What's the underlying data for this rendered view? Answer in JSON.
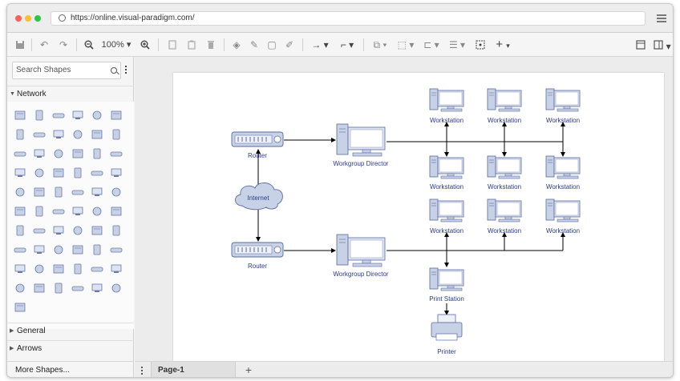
{
  "browser": {
    "url": "https://online.visual-paradigm.com/"
  },
  "toolbar": {
    "zoom": "100%"
  },
  "sidebar": {
    "search_placeholder": "Search Shapes",
    "sections": [
      {
        "label": "Network",
        "expanded": true
      },
      {
        "label": "General",
        "expanded": false
      },
      {
        "label": "Arrows",
        "expanded": false
      }
    ],
    "more_shapes": "More Shapes..."
  },
  "pages": {
    "tabs": [
      {
        "label": "Page-1"
      }
    ],
    "add_label": "+"
  },
  "diagram": {
    "router_top": "Router",
    "router_bottom": "Router",
    "internet": "Internet",
    "director_top": "Workgroup Director",
    "director_bottom": "Workgroup Director",
    "workstation": "Workstation",
    "print_station": "Print Station",
    "printer": "Printer"
  },
  "colors": {
    "accent": "#2b3a8c",
    "node_fill": "#c8d2e6",
    "node_stroke": "#5a6aa0"
  }
}
